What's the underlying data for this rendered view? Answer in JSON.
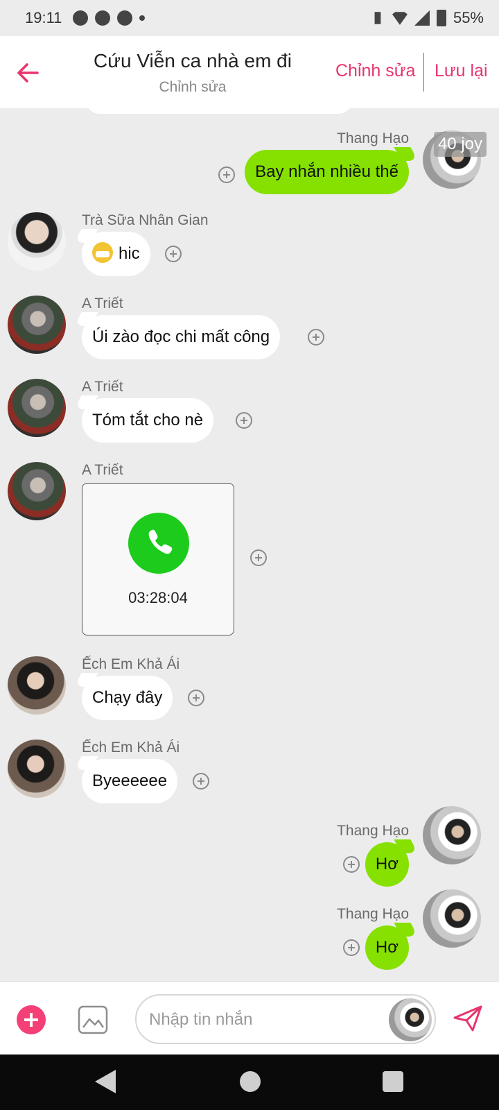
{
  "status_bar": {
    "time": "19:11",
    "battery": "55%",
    "notification_icons": [
      "messenger-icon",
      "chat-bubble-icon",
      "messenger-icon",
      "dot-icon"
    ],
    "system_icons": [
      "vibrate-icon",
      "wifi-icon",
      "signal-icon",
      "battery-icon"
    ]
  },
  "header": {
    "title": "Cứu Viễn ca nhà em đi",
    "subtitle": "Chỉnh sửa",
    "edit_label": "Chỉnh sửa",
    "save_label": "Lưu lại",
    "accent_color": "#e8356d"
  },
  "badges": {
    "joy": "40 joy"
  },
  "messages": [
    {
      "sender": "Thang Hạo",
      "side": "mine",
      "text": "Bay nhắn nhiều thế"
    },
    {
      "sender": "Trà Sữa Nhân Gian",
      "side": "theirs",
      "text": "hic",
      "emoji": "sneezing-face-emoji"
    },
    {
      "sender": "A Triết",
      "side": "theirs",
      "text": "Úi zào đọc chi mất công"
    },
    {
      "sender": "A Triết",
      "side": "theirs",
      "text": "Tóm tắt cho nè"
    },
    {
      "sender": "A Triết",
      "side": "theirs",
      "type": "call",
      "duration": "03:28:04"
    },
    {
      "sender": "Ếch Em Khả Ái",
      "side": "theirs",
      "text": "Chạy đây"
    },
    {
      "sender": "Ếch Em Khả Ái",
      "side": "theirs",
      "text": "Byeeeeee"
    },
    {
      "sender": "Thang Hạo",
      "side": "mine",
      "text": "Hơ"
    },
    {
      "sender": "Thang Hạo",
      "side": "mine",
      "text": "Hơ"
    }
  ],
  "colors": {
    "my_bubble": "#86e100",
    "their_bubble": "#ffffff",
    "call_green": "#1ccb1c",
    "add_button": "#f43f77"
  },
  "composer": {
    "placeholder": "Nhập tin nhắn"
  }
}
